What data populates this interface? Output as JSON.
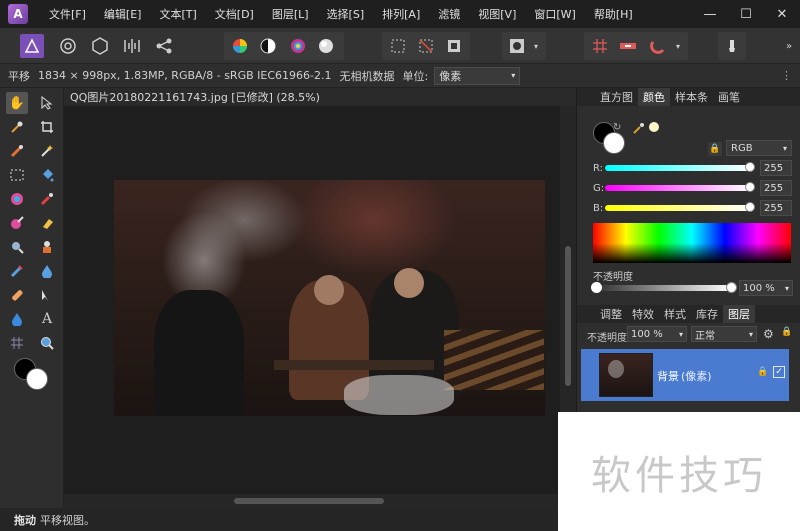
{
  "menu": {
    "items": [
      "文件[F]",
      "编辑[E]",
      "文本[T]",
      "文档[D]",
      "图层[L]",
      "选择[S]",
      "排列[A]",
      "滤镜",
      "视图[V]",
      "窗口[W]",
      "帮助[H]"
    ]
  },
  "window": {
    "minimize": "—",
    "maximize": "☐",
    "close": "✕"
  },
  "context": {
    "tool": "平移",
    "image_info": "1834 × 998px, 1.83MP, RGBA/8 - sRGB IEC61966-2.1",
    "camera": "无相机数据",
    "unit_label": "单位:",
    "unit_value": "像素"
  },
  "document": {
    "tab_title": "QQ图片20180221161743.jpg [已修改] (28.5%)"
  },
  "panel_top": {
    "tabs": [
      "直方图",
      "颜色",
      "样本条",
      "画笔"
    ],
    "active": "颜色",
    "mode": "RGB",
    "r_label": "R:",
    "g_label": "G:",
    "b_label": "B:",
    "r_value": "255",
    "g_value": "255",
    "b_value": "255",
    "opacity_label": "不透明度",
    "opacity_value": "100 %"
  },
  "panel_bottom": {
    "tabs": [
      "调整",
      "特效",
      "样式",
      "库存",
      "图层"
    ],
    "active": "图层",
    "opacity_label": "不透明度:",
    "opacity_value": "100 %",
    "blend_mode": "正常",
    "layer_name": "背景",
    "layer_type": "(像素)"
  },
  "status": {
    "key": "拖动",
    "text": "平移视图。"
  },
  "watermark": {
    "text": "软件技巧"
  },
  "colors": {
    "accent": "#4a7bd0",
    "app_logo": "#8a4fc0"
  }
}
